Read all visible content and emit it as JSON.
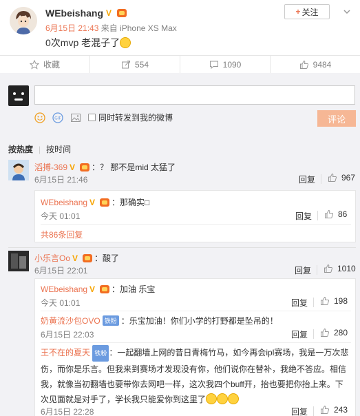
{
  "post": {
    "author": "WEbeishang",
    "time": "6月15日 21:43",
    "source": "来自 iPhone XS Max",
    "text": "0次mvp 老混子了",
    "follow_label": "关注"
  },
  "actions": {
    "favorite": "收藏",
    "repost": "554",
    "comment": "1090",
    "like": "9484"
  },
  "composer": {
    "repost_label": "同时转发到我的微博",
    "submit_label": "评论"
  },
  "sort": {
    "hot": "按热度",
    "time": "按时间"
  },
  "comments": [
    {
      "name": "滔搏-369",
      "text": "：？ 那不是mid 太猛了",
      "time": "6月15日 21:46",
      "reply": "回复",
      "likes": "967",
      "sub": [
        {
          "name": "WEbeishang",
          "text": "：那确实□",
          "time": "今天 01:01",
          "reply": "回复",
          "likes": "86"
        }
      ],
      "more": "共86条回复"
    },
    {
      "name": "小乐言Oo",
      "text": "：酸了",
      "time": "6月15日 22:01",
      "reply": "回复",
      "likes": "1010",
      "sub": [
        {
          "name": "WEbeishang",
          "text": "：加油 乐宝",
          "time": "今天 01:01",
          "reply": "回复",
          "likes": "198"
        },
        {
          "name": "奶黄流沙包OVO",
          "badge": "铁粉",
          "text": "：乐宝加油！你们小学的打野都是坠吊的！",
          "time": "6月15日 22:03",
          "reply": "回复",
          "likes": "280"
        },
        {
          "name": "王不在的夏天",
          "badge": "铁粉",
          "text": "：一起翻墙上网的昔日青梅竹马，如今再会ipl赛场，我是一万次悲伤，而你是乐言。但我来到赛场才发现没有你，他们说你在替补，我绝不答应。相信我，就像当初翻墙也要带你去网吧一样，这次我四个buff开，抬也要把你抬上来。下次见面就是对手了，学长我只能爱你到这里了",
          "time": "6月15日 22:28",
          "reply": "回复",
          "likes": "243"
        }
      ]
    }
  ]
}
